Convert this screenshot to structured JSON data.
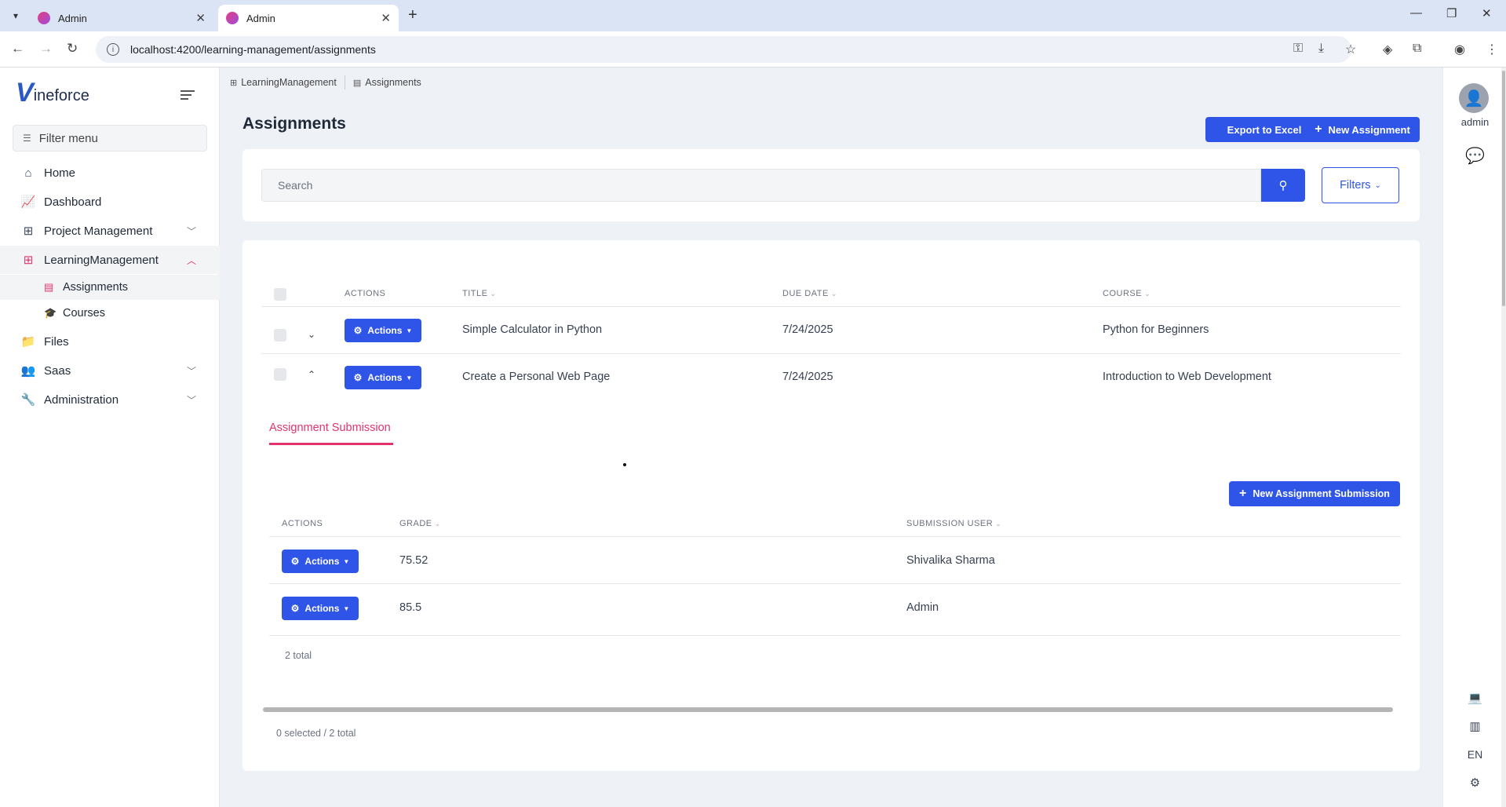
{
  "browser": {
    "tabs": [
      {
        "title": "Admin"
      },
      {
        "title": "Admin"
      }
    ],
    "url": "localhost:4200/learning-management/assignments"
  },
  "sidebar": {
    "logo_text": "ineforce",
    "logo_letter": "V",
    "filter_placeholder": "Filter menu",
    "items": [
      {
        "label": "Home",
        "icon": "home-icon"
      },
      {
        "label": "Dashboard",
        "icon": "chart-line-icon"
      },
      {
        "label": "Project Management",
        "icon": "sitemap-icon"
      },
      {
        "label": "LearningManagement",
        "icon": "sitemap-icon"
      },
      {
        "label": "Files",
        "icon": "folder-icon"
      },
      {
        "label": "Saas",
        "icon": "users-icon"
      },
      {
        "label": "Administration",
        "icon": "wrench-icon"
      }
    ],
    "subitems": [
      {
        "label": "Assignments",
        "icon": "file-icon"
      },
      {
        "label": "Courses",
        "icon": "graduation-cap-icon"
      }
    ]
  },
  "breadcrumb": [
    {
      "label": "LearningManagement"
    },
    {
      "label": "Assignments"
    }
  ],
  "page": {
    "title": "Assignments",
    "export_label": "Export to Excel",
    "new_label": "New Assignment"
  },
  "search": {
    "placeholder": "Search",
    "filters_label": "Filters"
  },
  "table": {
    "headers": {
      "actions": "ACTIONS",
      "title": "TITLE",
      "due_date": "DUE DATE",
      "course": "COURSE"
    },
    "rows": [
      {
        "actions": "Actions",
        "title": "Simple Calculator in Python",
        "due_date": "7/24/2025",
        "course": "Python for Beginners"
      },
      {
        "actions": "Actions",
        "title": "Create a Personal Web Page",
        "due_date": "7/24/2025",
        "course": "Introduction to Web Development"
      }
    ],
    "footer": "0 selected / 2 total"
  },
  "submission": {
    "tab_label": "Assignment Submission",
    "new_label": "New Assignment Submission",
    "headers": {
      "actions": "ACTIONS",
      "grade": "GRADE",
      "user": "SUBMISSION USER"
    },
    "rows": [
      {
        "actions": "Actions",
        "grade": "75.52",
        "user": "Shivalika Sharma"
      },
      {
        "actions": "Actions",
        "grade": "85.5",
        "user": "Admin"
      }
    ],
    "total": "2 total"
  },
  "rightbar": {
    "username": "admin",
    "language": "EN"
  },
  "colors": {
    "primary": "#2f55e8",
    "accent": "#e2336b"
  }
}
